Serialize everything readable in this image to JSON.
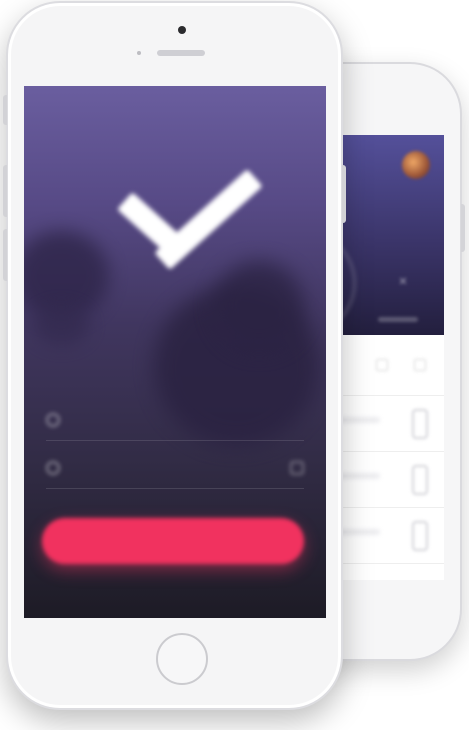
{
  "back_screen": {
    "rows": [
      "",
      "",
      ""
    ]
  },
  "front_screen": {
    "fields": [
      {
        "placeholder": ""
      },
      {
        "placeholder": ""
      }
    ],
    "cta_label": "",
    "footer_text": "",
    "footer_link": ""
  },
  "colors": {
    "accent": "#f1325f",
    "gradient_top": "#6a5e9f",
    "gradient_bottom": "#1d1b25",
    "device_frame": "#f5f5f6"
  },
  "icons": [
    "check-icon",
    "user-icon",
    "lock-icon",
    "eye-icon",
    "home-button"
  ]
}
